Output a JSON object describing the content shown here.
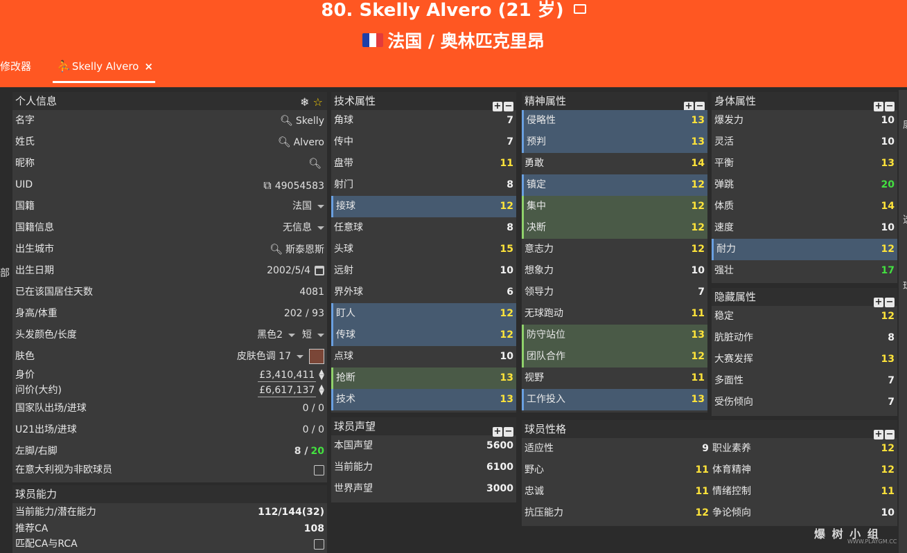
{
  "header": {
    "title": "80. Skelly Alvero (21 岁)",
    "subtitle": "法国 / 奥林匹克里昂",
    "flag_colors": [
      "#1e3fa8",
      "#ffffff",
      "#e33b3b"
    ]
  },
  "tabs": [
    {
      "label": "修改器"
    },
    {
      "label": "Skelly Alvero",
      "close": "×"
    }
  ],
  "left_edge_label": "部",
  "right_edge_labels": [
    "康",
    "选",
    "球"
  ],
  "personal": {
    "title": "个人信息",
    "rows": [
      {
        "label": "名字",
        "value": "Skelly"
      },
      {
        "label": "姓氏",
        "value": "Alvero"
      },
      {
        "label": "昵称",
        "value": ""
      },
      {
        "label": "UID",
        "value": "49054583"
      },
      {
        "label": "国籍",
        "value": "法国"
      },
      {
        "label": "国籍信息",
        "value": "无信息"
      },
      {
        "label": "出生城市",
        "value": "斯泰恩斯"
      },
      {
        "label": "出生日期",
        "value": "2002/5/4"
      },
      {
        "label": "已在该国居住天数",
        "value": "4081"
      },
      {
        "label": "身高/体重",
        "value": "202 / 93"
      },
      {
        "label": "头发颜色/长度",
        "value": "黑色2",
        "value2": "短"
      },
      {
        "label": "肤色",
        "value": "皮肤色调 17"
      },
      {
        "label": "身价",
        "value": "£3,410,411"
      },
      {
        "label": "问价(大约)",
        "value": "£6,617,137"
      },
      {
        "label": "国家队出场/进球",
        "value": "0 / 0"
      },
      {
        "label": "U21出场/进球",
        "value": "0 / 0"
      },
      {
        "label": "左脚/右脚",
        "value": "8 /",
        "value2": "20"
      },
      {
        "label": "在意大利视为非欧球员",
        "value": ""
      }
    ]
  },
  "ability": {
    "title": "球员能力",
    "rows": [
      {
        "label": "当前能力/潜在能力",
        "value": "112/144(32)"
      },
      {
        "label": "推荐CA",
        "value": "108"
      },
      {
        "label": "匹配CA与RCA",
        "value": ""
      }
    ]
  },
  "technical": {
    "title": "技术属性",
    "rows": [
      {
        "label": "角球",
        "value": "7",
        "c": "w",
        "h": ""
      },
      {
        "label": "传中",
        "value": "7",
        "c": "w",
        "h": ""
      },
      {
        "label": "盘带",
        "value": "11",
        "c": "y",
        "h": ""
      },
      {
        "label": "射门",
        "value": "8",
        "c": "w",
        "h": ""
      },
      {
        "label": "接球",
        "value": "12",
        "c": "y",
        "h": "blue"
      },
      {
        "label": "任意球",
        "value": "8",
        "c": "w",
        "h": ""
      },
      {
        "label": "头球",
        "value": "15",
        "c": "y",
        "h": ""
      },
      {
        "label": "远射",
        "value": "10",
        "c": "w",
        "h": ""
      },
      {
        "label": "界外球",
        "value": "6",
        "c": "w",
        "h": ""
      },
      {
        "label": "盯人",
        "value": "12",
        "c": "y",
        "h": "blue"
      },
      {
        "label": "传球",
        "value": "12",
        "c": "y",
        "h": "blue"
      },
      {
        "label": "点球",
        "value": "10",
        "c": "w",
        "h": ""
      },
      {
        "label": "抢断",
        "value": "13",
        "c": "y",
        "h": "green"
      },
      {
        "label": "技术",
        "value": "13",
        "c": "y",
        "h": "blue"
      }
    ]
  },
  "mental": {
    "title": "精神属性",
    "rows": [
      {
        "label": "侵略性",
        "value": "13",
        "c": "y",
        "h": "blue"
      },
      {
        "label": "预判",
        "value": "13",
        "c": "y",
        "h": "blue"
      },
      {
        "label": "勇敢",
        "value": "14",
        "c": "y",
        "h": ""
      },
      {
        "label": "镇定",
        "value": "12",
        "c": "y",
        "h": "blue"
      },
      {
        "label": "集中",
        "value": "12",
        "c": "y",
        "h": "green"
      },
      {
        "label": "决断",
        "value": "12",
        "c": "y",
        "h": "green"
      },
      {
        "label": "意志力",
        "value": "12",
        "c": "y",
        "h": ""
      },
      {
        "label": "想象力",
        "value": "10",
        "c": "w",
        "h": ""
      },
      {
        "label": "领导力",
        "value": "7",
        "c": "w",
        "h": ""
      },
      {
        "label": "无球跑动",
        "value": "11",
        "c": "y",
        "h": ""
      },
      {
        "label": "防守站位",
        "value": "13",
        "c": "y",
        "h": "green"
      },
      {
        "label": "团队合作",
        "value": "12",
        "c": "y",
        "h": "green"
      },
      {
        "label": "视野",
        "value": "11",
        "c": "y",
        "h": ""
      },
      {
        "label": "工作投入",
        "value": "13",
        "c": "y",
        "h": "blue"
      }
    ]
  },
  "physical": {
    "title": "身体属性",
    "rows": [
      {
        "label": "爆发力",
        "value": "10",
        "c": "w",
        "h": ""
      },
      {
        "label": "灵活",
        "value": "10",
        "c": "w",
        "h": ""
      },
      {
        "label": "平衡",
        "value": "13",
        "c": "y",
        "h": ""
      },
      {
        "label": "弹跳",
        "value": "20",
        "c": "g",
        "h": ""
      },
      {
        "label": "体质",
        "value": "14",
        "c": "y",
        "h": ""
      },
      {
        "label": "速度",
        "value": "10",
        "c": "w",
        "h": ""
      },
      {
        "label": "耐力",
        "value": "12",
        "c": "y",
        "h": "blue"
      },
      {
        "label": "强壮",
        "value": "17",
        "c": "g",
        "h": ""
      }
    ]
  },
  "hidden": {
    "title": "隐藏属性",
    "rows": [
      {
        "label": "稳定",
        "value": "12",
        "c": "y",
        "h": ""
      },
      {
        "label": "肮脏动作",
        "value": "8",
        "c": "w",
        "h": ""
      },
      {
        "label": "大赛发挥",
        "value": "13",
        "c": "y",
        "h": ""
      },
      {
        "label": "多面性",
        "value": "7",
        "c": "w",
        "h": ""
      },
      {
        "label": "受伤倾向",
        "value": "7",
        "c": "w",
        "h": ""
      }
    ]
  },
  "reputation": {
    "title": "球员声望",
    "rows": [
      {
        "label": "本国声望",
        "value": "5600"
      },
      {
        "label": "当前能力",
        "value": "6100"
      },
      {
        "label": "世界声望",
        "value": "3000"
      }
    ]
  },
  "personality": {
    "title": "球员性格",
    "left": [
      {
        "label": "适应性",
        "value": "9",
        "c": "w"
      },
      {
        "label": "野心",
        "value": "11",
        "c": "y"
      },
      {
        "label": "忠诚",
        "value": "11",
        "c": "y"
      },
      {
        "label": "抗压能力",
        "value": "12",
        "c": "y"
      }
    ],
    "right": [
      {
        "label": "职业素养",
        "value": "12",
        "c": "y"
      },
      {
        "label": "体育精神",
        "value": "12",
        "c": "y"
      },
      {
        "label": "情绪控制",
        "value": "11",
        "c": "y"
      },
      {
        "label": "争论倾向",
        "value": "10",
        "c": "w"
      }
    ]
  },
  "watermark": {
    "text": "爆 树 小 组",
    "sub": "WWW.PLAYGM.CC"
  }
}
